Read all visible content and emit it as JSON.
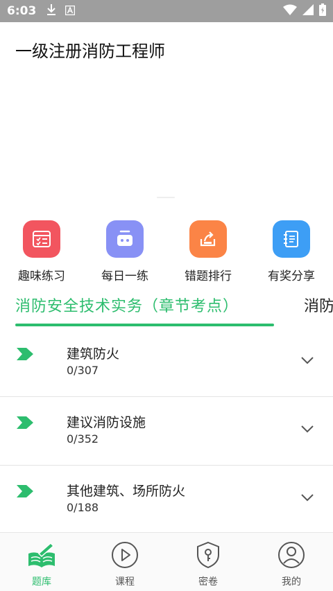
{
  "status_bar": {
    "time": "6:03",
    "icons": [
      "download-icon",
      "a-icon",
      "wifi-icon",
      "signal-icon",
      "battery-icon"
    ]
  },
  "app_bar": {
    "title": "一级注册消防工程师"
  },
  "quick_actions": [
    {
      "label": "趣味练习",
      "icon": "checklist-icon",
      "color": "#f2555f"
    },
    {
      "label": "每日一练",
      "icon": "robot-icon",
      "color": "#8891f5"
    },
    {
      "label": "错题排行",
      "icon": "export-icon",
      "color": "#fb8446"
    },
    {
      "label": "有奖分享",
      "icon": "notebook-icon",
      "color": "#3d9ef5"
    }
  ],
  "tabs": {
    "active": "消防安全技术实务（章节考点）",
    "next": "消防"
  },
  "chapters": [
    {
      "name": "建筑防火",
      "progress": "0/307"
    },
    {
      "name": "建议消防设施",
      "progress": "0/352"
    },
    {
      "name": "其他建筑、场所防火",
      "progress": "0/188"
    }
  ],
  "bottom_nav": [
    {
      "label": "题库",
      "icon": "book-pen-icon",
      "active": true
    },
    {
      "label": "课程",
      "icon": "play-circle-icon",
      "active": false
    },
    {
      "label": "密卷",
      "icon": "shield-key-icon",
      "active": false
    },
    {
      "label": "我的",
      "icon": "user-circle-icon",
      "active": false
    }
  ],
  "colors": {
    "accent": "#2dbd6e",
    "status_bar": "#9e9e9e"
  }
}
